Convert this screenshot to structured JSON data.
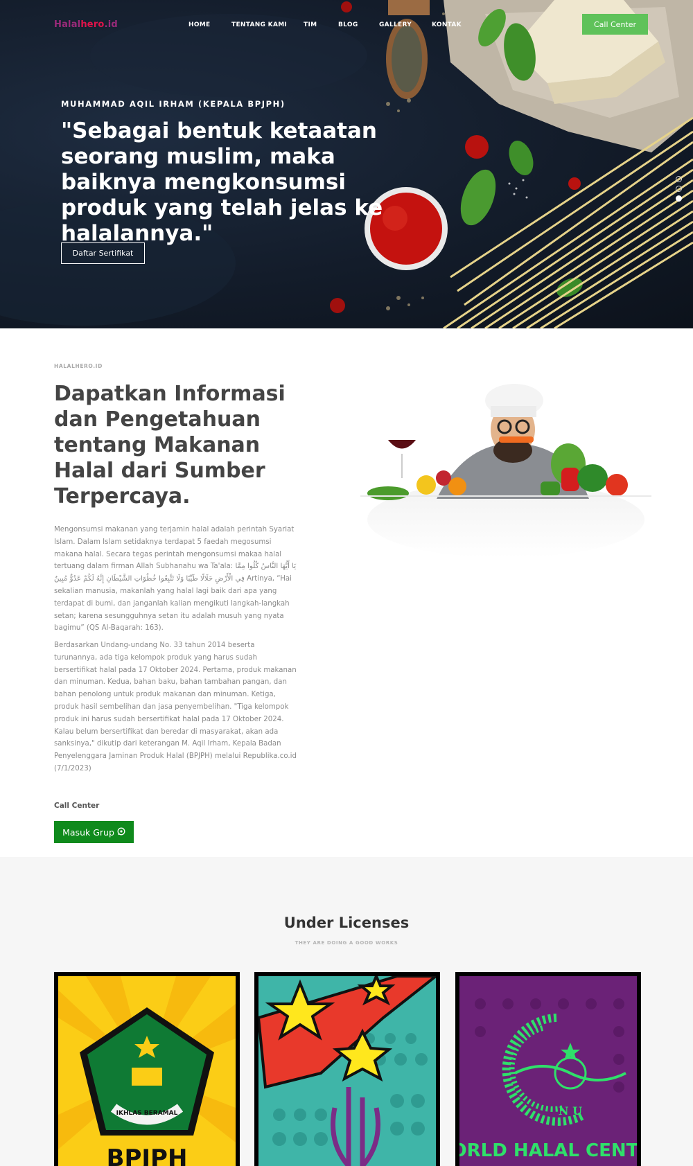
{
  "nav": {
    "logo": {
      "part1": "Halal",
      "part2": "hero",
      "part3": ".id"
    },
    "items": [
      "HOME",
      "TENTANG KAMI",
      "TIM",
      "BLOG",
      "GALLERY",
      "KONTAK"
    ],
    "cta": "Call Center"
  },
  "hero": {
    "subtitle": "MUHAMMAD AQIL IRHAM (KEPALA BPJPH)",
    "quote": "\"Sebagai bentuk ketaatan seorang muslim, maka baiknya mengkonsumsi produk yang telah jelas ke halalannya.\"",
    "button": "Daftar Sertifikat",
    "slides": 3,
    "active_slide": 3
  },
  "about": {
    "eyebrow": "HALALHERO.ID",
    "title": "Dapatkan Informasi dan Pengetahuan tentang Makanan Halal dari Sumber Terpercaya.",
    "paragraph1": "Mengonsumsi makanan yang terjamin halal adalah perintah Syariat Islam. Dalam Islam setidaknya terdapat 5 faedah megosumsi makana halal. Secara tegas perintah mengonsumsi makaa halal tertuang dalam firman Allah Subhanahu wa Ta'ala: يَا أَيُّهَا النَّاسُ كُلُوا مِمَّا فِي الْأَرْضِ حَلَالًا طَيِّبًا وَلَا تَتَّبِعُوا خُطُوَاتِ الشَّيْطَانِ إِنَّهُ لَكُمْ عَدُوٌّ مُبِينٌ Artinya, “Hai sekalian manusia, makanlah yang halal lagi baik dari apa yang terdapat di bumi, dan janganlah kalian mengikuti langkah-langkah setan; karena sesungguhnya setan itu adalah musuh yang nyata bagimu” (QS Al-Baqarah: 163).",
    "paragraph2": "Berdasarkan Undang-undang No. 33 tahun 2014 beserta turunannya, ada tiga kelompok produk yang harus sudah bersertifikat halal pada 17 Oktober 2024. Pertama, produk makanan dan minuman. Kedua, bahan baku, bahan tambahan pangan, dan bahan penolong untuk produk makanan dan minuman. Ketiga, produk hasil sembelihan dan jasa penyembelihan. \"Tiga kelompok produk ini harus sudah bersertifikat halal pada 17 Oktober 2024. Kalau belum bersertifikat dan beredar di masyarakat, akan ada sanksinya,\" dikutip dari keterangan M. Aqil Irham, Kepala Badan Penyelenggara Jaminan Produk Halal (BPJPH) melalui Republika.co.id (7/1/2023)",
    "call_center_label": "Call Center",
    "whatsapp_button": "Masuk Grup"
  },
  "licenses": {
    "title": "Under Licenses",
    "subtitle": "THEY ARE DOING A GOOD WORKS",
    "cards": [
      {
        "text": "BPJPH",
        "banner": "IKHLAS BERAMAL"
      },
      {
        "text": ""
      },
      {
        "text": "WORLD HALAL CENTRE",
        "letters": "N U"
      }
    ]
  },
  "colors": {
    "accent_green": "#5fc25a",
    "whatsapp_green": "#0f8a1c",
    "logo_pink": "#e0134a",
    "logo_purple": "#9a2a7a"
  }
}
